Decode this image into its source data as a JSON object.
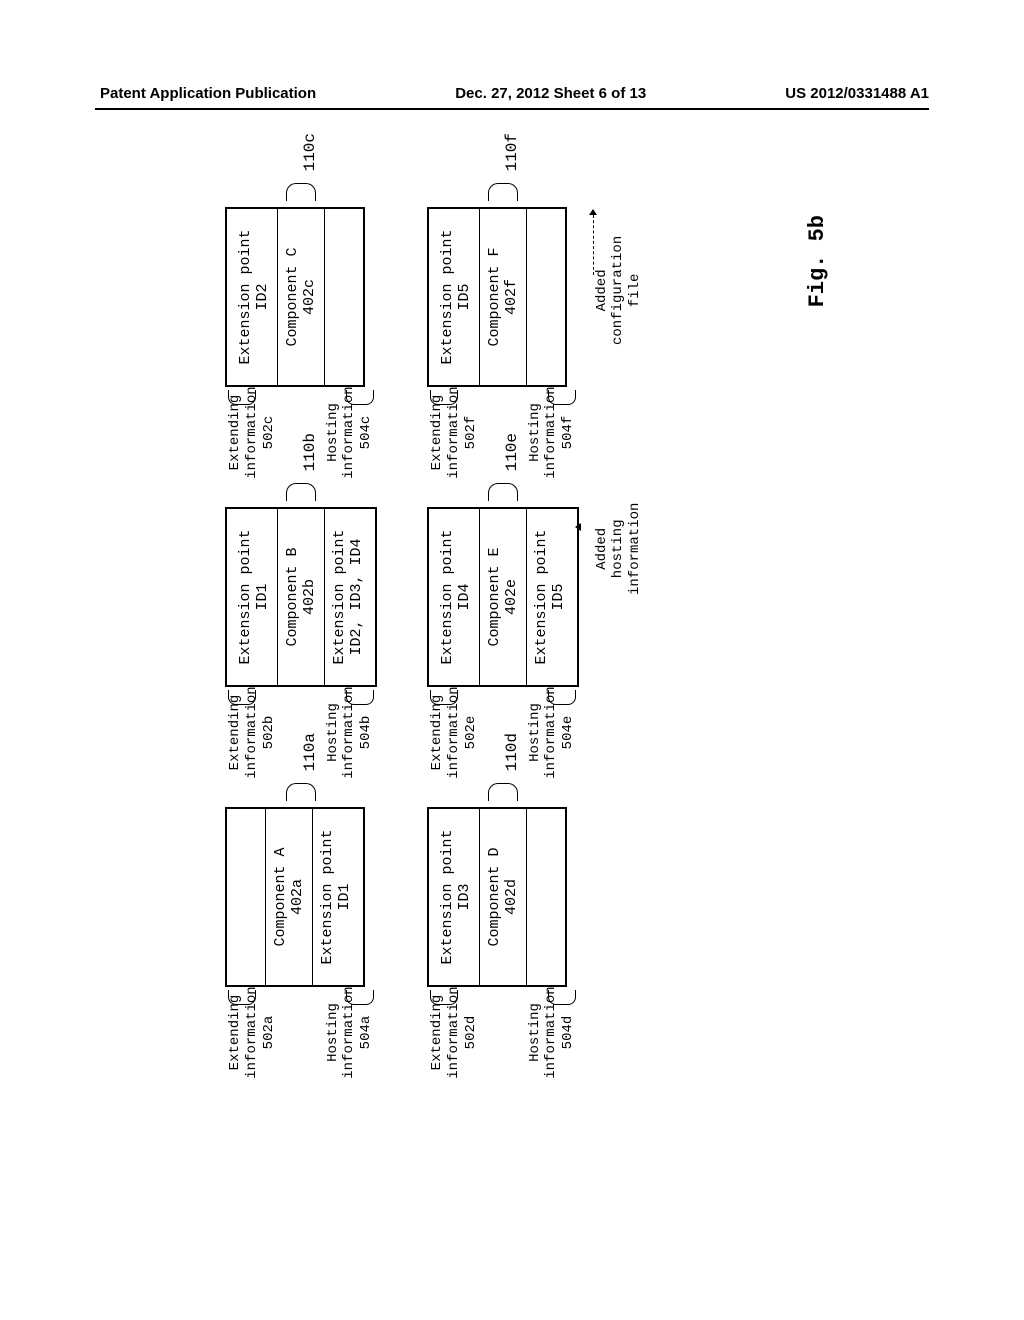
{
  "header": {
    "left": "Patent Application Publication",
    "center": "Dec. 27, 2012  Sheet 6 of 13",
    "right": "US 2012/0331488 A1"
  },
  "figure_caption": "Fig. 5b",
  "components": {
    "a": {
      "name": "Component A",
      "name_ref": "402a",
      "ext_point_bottom": "Extension point",
      "ext_point_bottom_id": "ID1",
      "box_ref": "110a",
      "extending_label": "Extending\ninformation",
      "extending_ref": "502a",
      "hosting_label": "Hosting\ninformation",
      "hosting_ref": "504a"
    },
    "b": {
      "ext_point_top": "Extension point",
      "ext_point_top_id": "ID1",
      "name": "Component B",
      "name_ref": "402b",
      "ext_point_bottom": "Extension point",
      "ext_point_bottom_id": "ID2, ID3, ID4",
      "box_ref": "110b",
      "extending_label": "Extending\ninformation",
      "extending_ref": "502b",
      "hosting_label": "Hosting\ninformation",
      "hosting_ref": "504b"
    },
    "c": {
      "ext_point_top": "Extension point",
      "ext_point_top_id": "ID2",
      "name": "Component C",
      "name_ref": "402c",
      "box_ref": "110c",
      "extending_label": "Extending\ninformation",
      "extending_ref": "502c",
      "hosting_label": "Hosting\ninformation",
      "hosting_ref": "504c"
    },
    "d": {
      "ext_point_top": "Extension point",
      "ext_point_top_id": "ID3",
      "name": "Component D",
      "name_ref": "402d",
      "box_ref": "110d",
      "extending_label": "Extending\ninformation",
      "extending_ref": "502d",
      "hosting_label": "Hosting\ninformation",
      "hosting_ref": "504d"
    },
    "e": {
      "ext_point_top": "Extension point",
      "ext_point_top_id": "ID4",
      "name": "Component E",
      "name_ref": "402e",
      "ext_point_bottom": "Extension point",
      "ext_point_bottom_id": "ID5",
      "box_ref": "110e",
      "extending_label": "Extending\ninformation",
      "extending_ref": "502e",
      "hosting_label": "Hosting\ninformation",
      "hosting_ref": "504e",
      "annotation": "Added\nhosting\ninformation"
    },
    "f": {
      "ext_point_top": "Extension point",
      "ext_point_top_id": "ID5",
      "name": "Component F",
      "name_ref": "402f",
      "box_ref": "110f",
      "extending_label": "Extending\ninformation",
      "extending_ref": "502f",
      "hosting_label": "Hosting\ninformation",
      "hosting_ref": "504f",
      "annotation": "Added\nconfiguration\nfile"
    }
  }
}
